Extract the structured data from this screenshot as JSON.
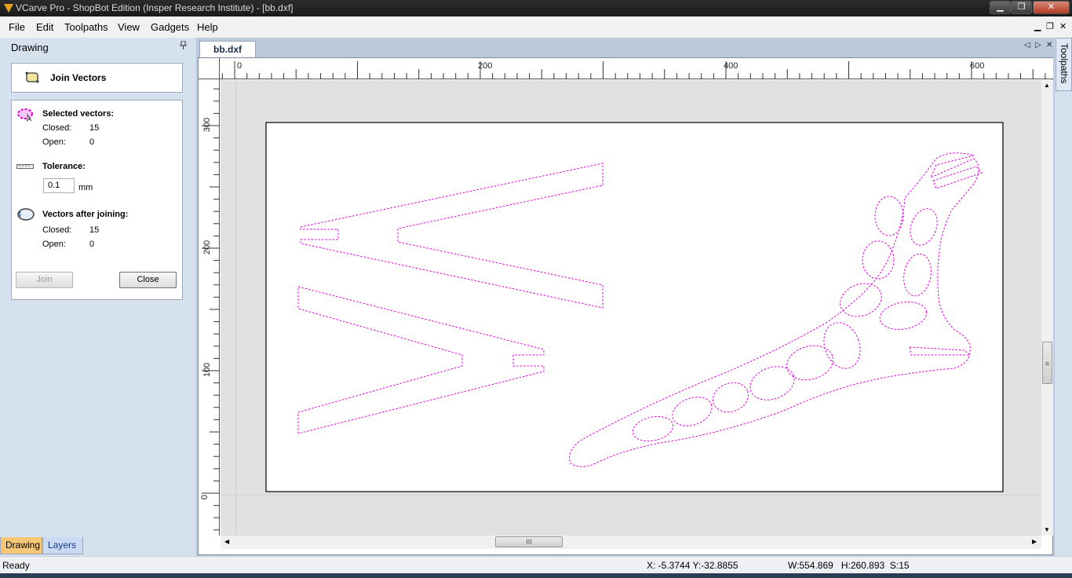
{
  "window": {
    "title": "VCarve Pro - ShopBot Edition (Insper Research Institute) - [bb.dxf]",
    "controls": {
      "minimize": "▁",
      "maximize": "❐",
      "close": "✕"
    }
  },
  "menubar": {
    "items": [
      "File",
      "Edit",
      "Toolpaths",
      "View",
      "Gadgets",
      "Help"
    ],
    "mdi": {
      "minimize": "▁",
      "restore": "❐",
      "close": "✕"
    }
  },
  "left_panel": {
    "title": "Drawing",
    "pin": "📌",
    "header": {
      "label": "Join Vectors",
      "icon": "join-vectors-icon"
    },
    "selected": {
      "heading": "Selected vectors:",
      "closed_label": "Closed:",
      "closed_value": "15",
      "open_label": "Open:",
      "open_value": "0"
    },
    "tolerance": {
      "heading": "Tolerance:",
      "value": "0.1",
      "unit": "mm"
    },
    "after": {
      "heading": "Vectors after joining:",
      "closed_label": "Closed:",
      "closed_value": "15",
      "open_label": "Open:",
      "open_value": "0"
    },
    "buttons": {
      "join": "Join",
      "close": "Close"
    },
    "tabs": [
      "Drawing",
      "Layers"
    ]
  },
  "document": {
    "tab": "bb.dxf",
    "nav": {
      "prev": "◁",
      "next": "▷",
      "close": "✕"
    },
    "ruler_top": [
      "0",
      "200",
      "400",
      "600"
    ],
    "ruler_left": [
      "300",
      "200",
      "100",
      "0"
    ],
    "vector_color": "#e000e0",
    "scroll_grip": "III"
  },
  "right_tab": "Toolpaths",
  "status": {
    "ready": "Ready",
    "coords": "X: -5.3744 Y:-32.8855",
    "dims": "W:554.869   H:260.893  S:15"
  }
}
